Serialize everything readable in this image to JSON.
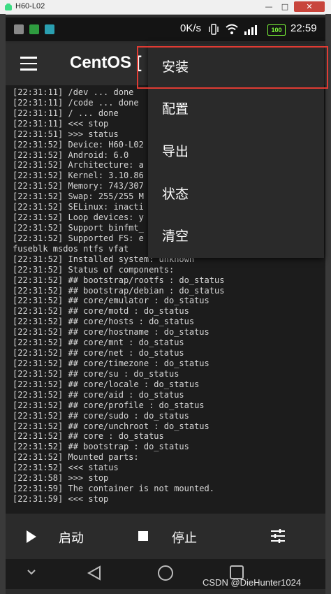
{
  "window": {
    "title": "H60-L02",
    "minimize": "—",
    "maximize": "□",
    "close": "✕"
  },
  "status_bar": {
    "network_speed": "0K/s",
    "battery": "100",
    "time": "22:59"
  },
  "app_bar": {
    "title": "CentOS ["
  },
  "menu": {
    "items": [
      {
        "label": "安装"
      },
      {
        "label": "配置"
      },
      {
        "label": "导出"
      },
      {
        "label": "状态"
      },
      {
        "label": "清空"
      }
    ]
  },
  "log": {
    "lines": [
      "[22:31:11] /dev ... done",
      "[22:31:11] /code ... done",
      "[22:31:11] / ... done",
      "[22:31:11] <<< stop",
      "[22:31:51] >>> status",
      "[22:31:52] Device: H60-L02",
      "[22:31:52] Android: 6.0",
      "[22:31:52] Architecture: a",
      "[22:31:52] Kernel: 3.10.86",
      "[22:31:52] Memory: 743/307",
      "[22:31:52] Swap: 255/255 M",
      "[22:31:52] SELinux: inacti",
      "[22:31:52] Loop devices: y",
      "[22:31:52] Support binfmt_",
      "[22:31:52] Supported FS: e",
      "fuseblk msdos ntfs vfat",
      "[22:31:52] Installed system: unknown",
      "[22:31:52] Status of components:",
      "[22:31:52] ## bootstrap/rootfs : do_status",
      "[22:31:52] ## bootstrap/debian : do_status",
      "[22:31:52] ## core/emulator : do_status",
      "[22:31:52] ## core/motd : do_status",
      "[22:31:52] ## core/hosts : do_status",
      "[22:31:52] ## core/hostname : do_status",
      "[22:31:52] ## core/mnt : do_status",
      "[22:31:52] ## core/net : do_status",
      "[22:31:52] ## core/timezone : do_status",
      "[22:31:52] ## core/su : do_status",
      "[22:31:52] ## core/locale : do_status",
      "[22:31:52] ## core/aid : do_status",
      "[22:31:52] ## core/profile : do_status",
      "[22:31:52] ## core/sudo : do_status",
      "[22:31:52] ## core/unchroot : do_status",
      "[22:31:52] ## core : do_status",
      "[22:31:52] ## bootstrap : do_status",
      "[22:31:52] Mounted parts:",
      "[22:31:52] <<< status",
      "[22:31:58] >>> stop",
      "[22:31:59] The container is not mounted.",
      "[22:31:59] <<< stop"
    ]
  },
  "toolbar": {
    "start_label": "启动",
    "stop_label": "停止"
  },
  "watermark": "CSDN @DieHunter1024",
  "colors": {
    "highlight_border": "#e03b33",
    "battery": "#7fff3a"
  }
}
